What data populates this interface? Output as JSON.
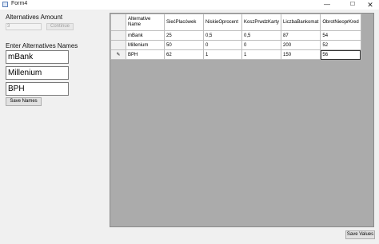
{
  "window": {
    "title": "Form4",
    "minimize_glyph": "—",
    "maximize_glyph": "☐",
    "close_glyph": "✕"
  },
  "amount": {
    "label": "Alternatives Amount",
    "value": "3",
    "continue_label": "Continue"
  },
  "names": {
    "label": "Enter Alternatives Names",
    "values": [
      "mBank",
      "Millenium",
      "BPH"
    ],
    "save_label": "Save Names"
  },
  "grid": {
    "columns": [
      "Alternative Name",
      "SiećPlacówek",
      "NiskieOprocent",
      "KoszPrwdzKarty",
      "LiczbaBankomat",
      "ObrotNieoprKred"
    ],
    "rows": [
      [
        "mBank",
        "25",
        "0,5",
        "0,5",
        "87",
        "54"
      ],
      [
        "Millenium",
        "50",
        "0",
        "0",
        "200",
        "52"
      ],
      [
        "BPH",
        "62",
        "1",
        "1",
        "150",
        "56"
      ]
    ],
    "edit_row_glyph": "✎"
  },
  "save_values_label": "Save Values"
}
